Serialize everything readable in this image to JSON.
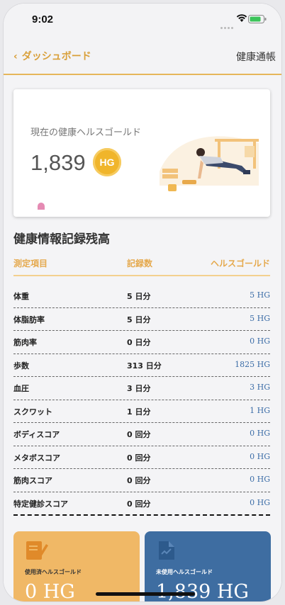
{
  "status_bar": {
    "time": "9:02"
  },
  "nav": {
    "back_label": "ダッシュボード",
    "title": "健康通帳"
  },
  "summary": {
    "label": "現在の健康ヘルスゴールド",
    "amount": "1,839",
    "coin_text": "HG"
  },
  "section_title": "健康情報記録残高",
  "table": {
    "headers": [
      "測定項目",
      "記録数",
      "ヘルスゴールド"
    ],
    "rows": [
      {
        "item": "体重",
        "count": "5 日分",
        "gold": "5 HG"
      },
      {
        "item": "体脂肪率",
        "count": "5 日分",
        "gold": "5 HG"
      },
      {
        "item": "筋肉率",
        "count": "0 日分",
        "gold": "0 HG"
      },
      {
        "item": "歩数",
        "count": "313 日分",
        "gold": "1825 HG"
      },
      {
        "item": "血圧",
        "count": "3 日分",
        "gold": "3 HG"
      },
      {
        "item": "スクワット",
        "count": "1 日分",
        "gold": "1 HG"
      },
      {
        "item": "ボディスコア",
        "count": "0 回分",
        "gold": "0 HG"
      },
      {
        "item": "メタボスコア",
        "count": "0 回分",
        "gold": "0 HG"
      },
      {
        "item": "筋肉スコア",
        "count": "0 回分",
        "gold": "0 HG"
      },
      {
        "item": "特定健診スコア",
        "count": "0 回分",
        "gold": "0 HG"
      }
    ]
  },
  "tiles": {
    "used": {
      "label": "使用済ヘルスゴールド",
      "value": "0 HG",
      "icon": "edit-document-icon"
    },
    "unused": {
      "label": "未使用ヘルスゴールド",
      "value": "1,839 HG",
      "icon": "document-chart-icon"
    }
  },
  "colors": {
    "accent": "#e6b65a",
    "gold_value": "#3c6da7",
    "used_tile": "#f0b866",
    "unused_tile": "#3e6da1"
  }
}
